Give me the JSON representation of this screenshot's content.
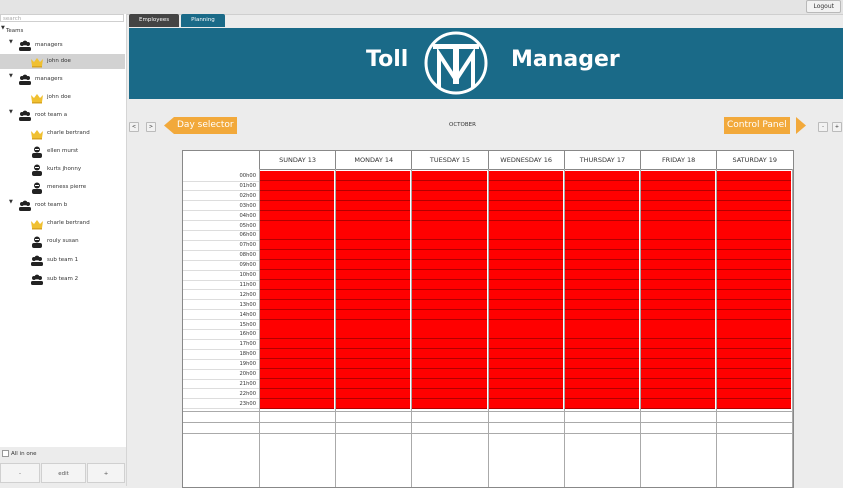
{
  "header": {
    "logout_label": "Logout"
  },
  "sidebar": {
    "search_placeholder": "search",
    "tree": [
      {
        "label": "Teams",
        "icon": "none",
        "twisty": "▼",
        "selected": false
      },
      {
        "label": "managers",
        "icon": "team-icon",
        "twisty": "▼",
        "selected": false
      },
      {
        "label": "john doe",
        "icon": "crown-icon",
        "twisty": "",
        "selected": true
      },
      {
        "label": "managers",
        "icon": "team-icon",
        "twisty": "▼",
        "selected": false
      },
      {
        "label": "john doe",
        "icon": "crown-icon",
        "twisty": "",
        "selected": false
      },
      {
        "label": "root team a",
        "icon": "team-icon",
        "twisty": "▼",
        "selected": false
      },
      {
        "label": "charle bertrand",
        "icon": "crown-icon",
        "twisty": "",
        "selected": false
      },
      {
        "label": "ellen murst",
        "icon": "person-icon",
        "twisty": "",
        "selected": false
      },
      {
        "label": "kurts jhonny",
        "icon": "person-icon",
        "twisty": "",
        "selected": false
      },
      {
        "label": "meness pierre",
        "icon": "person-icon",
        "twisty": "",
        "selected": false
      },
      {
        "label": "root team b",
        "icon": "team-icon",
        "twisty": "▼",
        "selected": false
      },
      {
        "label": "charle bertrand",
        "icon": "crown-icon",
        "twisty": "",
        "selected": false
      },
      {
        "label": "rouly susan",
        "icon": "person-icon",
        "twisty": "",
        "selected": false
      },
      {
        "label": "sub team 1",
        "icon": "team-icon",
        "twisty": "",
        "selected": false
      },
      {
        "label": "sub team 2",
        "icon": "team-icon",
        "twisty": "",
        "selected": false
      }
    ],
    "all_in_one_label": "All in one",
    "buttons": {
      "minus": "-",
      "edit": "edit",
      "plus": "+"
    }
  },
  "tabs": [
    {
      "label": "Employees",
      "active": false
    },
    {
      "label": "Planning",
      "active": true
    }
  ],
  "banner": {
    "left_word": "Toll",
    "right_word": "Manager",
    "logo_letters": "TM"
  },
  "day_selector": {
    "prev": "<",
    "next": ">",
    "callout": "Day selector"
  },
  "control_panel": {
    "callout": "Control Panel",
    "minus": "-",
    "plus": "+"
  },
  "month_label": "OCTOBER",
  "planning": {
    "days": [
      "SUNDAY 13",
      "MONDAY 14",
      "TUESDAY 15",
      "WEDNESDAY 16",
      "THURSDAY 17",
      "FRIDAY 18",
      "SATURDAY 19"
    ],
    "hours": [
      "00h00",
      "01h00",
      "02h00",
      "03h00",
      "04h00",
      "05h00",
      "06h00",
      "07h00",
      "08h00",
      "09h00",
      "10h00",
      "11h00",
      "12h00",
      "13h00",
      "14h00",
      "15h00",
      "16h00",
      "17h00",
      "18h00",
      "19h00",
      "20h00",
      "21h00",
      "22h00",
      "23h00"
    ],
    "slot_color": "#ff0000"
  },
  "colors": {
    "accent": "#1a6a88",
    "callout": "#f2a93b"
  }
}
